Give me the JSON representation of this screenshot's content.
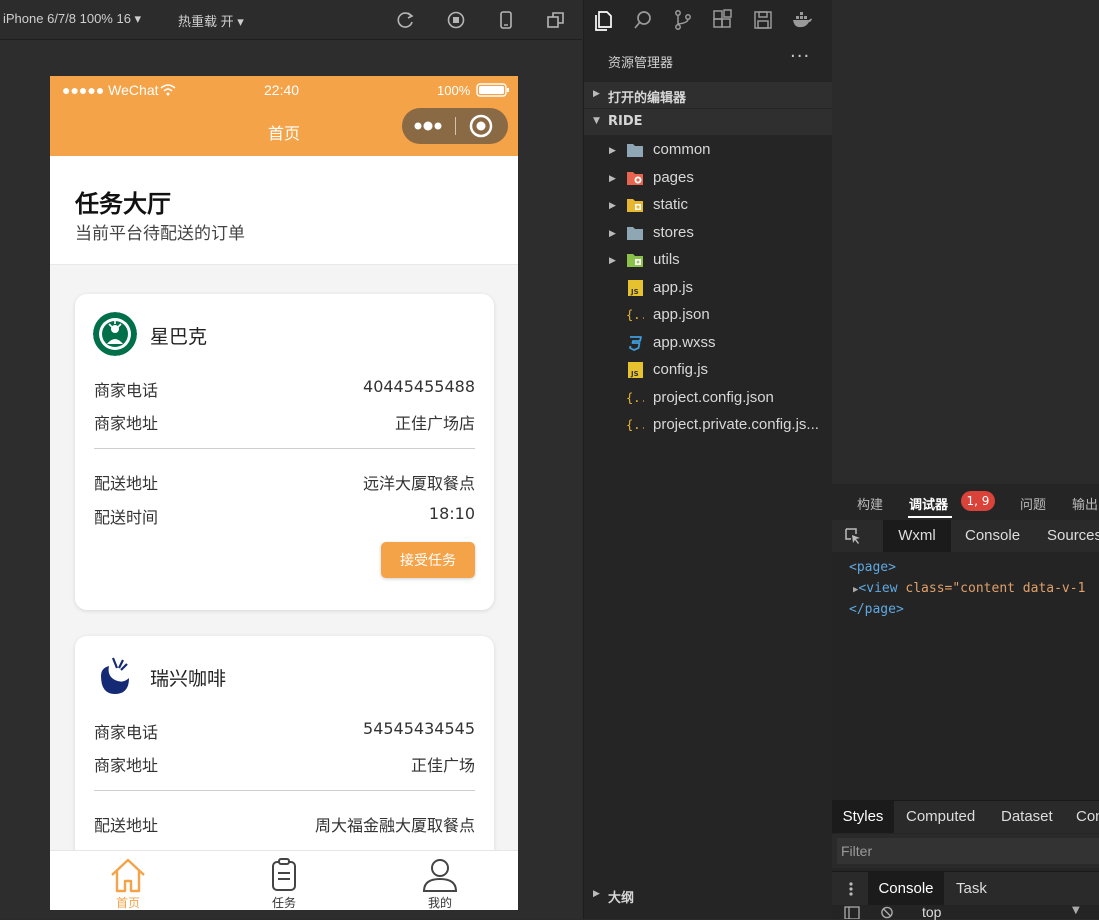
{
  "sim_toolbar": {
    "device": "iPhone 6/7/8 100% 16 ▾",
    "hot_reload": "热重载 开 ▾"
  },
  "phone": {
    "status": {
      "carrier": "●●●●● WeChat",
      "time": "22:40",
      "battery": "100%"
    },
    "nav_title": "首页",
    "header": {
      "title": "任务大厅",
      "subtitle": "当前平台待配送的订单"
    },
    "labels": {
      "phone": "商家电话",
      "address": "商家地址",
      "delivery_address": "配送地址",
      "delivery_time": "配送时间",
      "accept": "接受任务"
    },
    "orders": [
      {
        "merchant": "星巴克",
        "phone": "40445455488",
        "address": "正佳广场店",
        "delivery_address": "远洋大厦取餐点",
        "delivery_time": "18:10"
      },
      {
        "merchant": "瑞兴咖啡",
        "phone": "54545434545",
        "address": "正佳广场",
        "delivery_address": "周大福金融大厦取餐点"
      }
    ],
    "tabs": [
      {
        "label": "首页",
        "icon": "home-icon",
        "active": true
      },
      {
        "label": "任务",
        "icon": "clipboard-icon",
        "active": false
      },
      {
        "label": "我的",
        "icon": "user-icon",
        "active": false
      }
    ],
    "accent": "#f4a348"
  },
  "explorer": {
    "title": "资源管理器",
    "more": "···",
    "sections": {
      "open_editors": "打开的编辑器",
      "project": "RIDE",
      "outline": "大纲"
    },
    "items": [
      {
        "name": "common",
        "icon": "folder-icon"
      },
      {
        "name": "pages",
        "icon": "folder-pages-icon"
      },
      {
        "name": "static",
        "icon": "folder-static-icon"
      },
      {
        "name": "stores",
        "icon": "folder-icon"
      },
      {
        "name": "utils",
        "icon": "folder-utils-icon"
      },
      {
        "name": "app.js",
        "icon": "js-file-icon"
      },
      {
        "name": "app.json",
        "icon": "json-file-icon"
      },
      {
        "name": "app.wxss",
        "icon": "css-file-icon"
      },
      {
        "name": "config.js",
        "icon": "js-file-icon"
      },
      {
        "name": "project.config.json",
        "icon": "json-file-icon"
      },
      {
        "name": "project.private.config.js...",
        "icon": "json-file-icon"
      }
    ]
  },
  "debugger": {
    "tabs": {
      "build": "构建",
      "debugger": "调试器",
      "badge": "1, 9",
      "issues": "问题",
      "output": "输出"
    },
    "devtools_tabs": {
      "wxml": "Wxml",
      "console": "Console",
      "sources": "Sources"
    },
    "code": {
      "line1": "<page>",
      "line2_tag": "<view",
      "line2_attr": " class=",
      "line2_val": "\"content data-v-1",
      "line3": "</page>"
    },
    "style_tabs": {
      "styles": "Styles",
      "computed": "Computed",
      "dataset": "Dataset",
      "component": "Con"
    },
    "filter_placeholder": "Filter",
    "console_tabs": {
      "console": "Console",
      "task": "Task"
    },
    "context": "top"
  }
}
